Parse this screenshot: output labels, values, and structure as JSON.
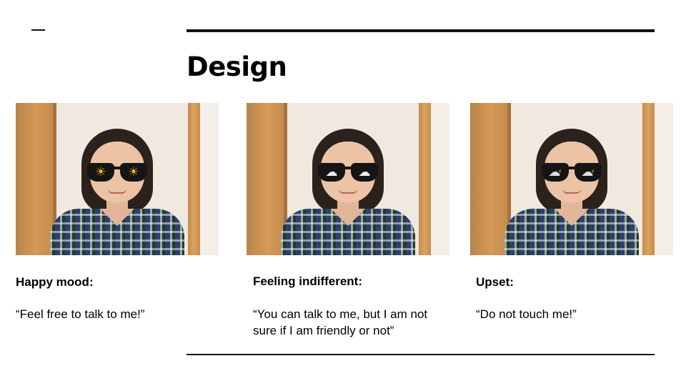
{
  "slide": {
    "title": "Design"
  },
  "panels": [
    {
      "mood_label": "Happy mood:",
      "quote": "“Feel free to talk to me!”",
      "lens_icon": "sun-icon",
      "lens_glyph": "☀"
    },
    {
      "mood_label": "Feeling indifferent:",
      "quote": "“You can talk to me, but I am not sure if I am friendly or not”",
      "lens_icon": "cloud-icon",
      "lens_glyph": "☁"
    },
    {
      "mood_label": "Upset:",
      "quote": "“Do not touch me!”",
      "lens_icon": "storm-cloud-icon",
      "lens_glyph": "☁"
    }
  ],
  "colors": {
    "rule": "#111111",
    "sun": "#f2b705",
    "lightning": "#f5c400"
  }
}
